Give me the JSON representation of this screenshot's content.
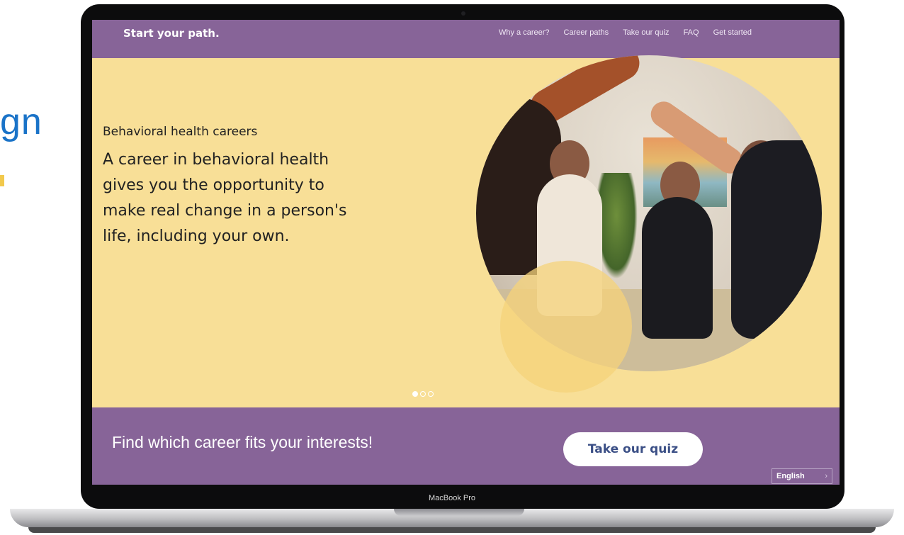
{
  "background": {
    "heading_fragment": "gn"
  },
  "laptop": {
    "model_label": "MacBook Pro"
  },
  "nav": {
    "brand": "Start your path.",
    "links": [
      "Why a career?",
      "Career paths",
      "Take our quiz",
      "FAQ",
      "Get started"
    ]
  },
  "hero": {
    "kicker": "Behavioral health careers",
    "title": "A career in behavioral health gives you the opportunity to make real change in a person's life, including your own.",
    "image_icon": "group-high-five-photo",
    "carousel": {
      "slide_count": 3,
      "active_slide": 1
    }
  },
  "quiz_band": {
    "prompt": "Find which career fits your interests!",
    "button_label": "Take our quiz"
  },
  "language": {
    "selected": "English",
    "chevron": "›"
  },
  "colors": {
    "brand_purple": "#876498",
    "hero_yellow": "#f8df97",
    "button_text": "#3b4f86",
    "background_heading": "#1a73c8"
  }
}
